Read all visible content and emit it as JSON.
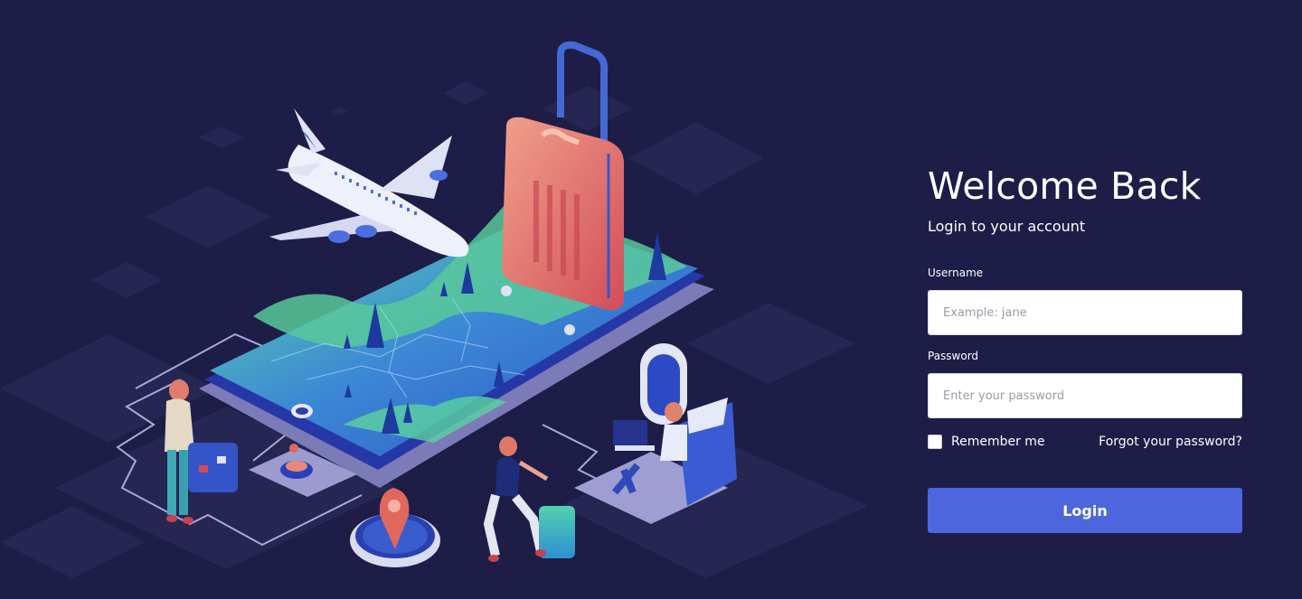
{
  "login": {
    "title": "Welcome Back",
    "subtitle": "Login to your account",
    "username_label": "Username",
    "username_placeholder": "Example: jane",
    "username_value": "",
    "password_label": "Password",
    "password_placeholder": "Enter your password",
    "password_value": "",
    "remember_label": "Remember me",
    "remember_checked": false,
    "forgot_label": "Forgot your password?",
    "login_button_label": "Login"
  },
  "colors": {
    "background": "#1d1d47",
    "accent": "#4d66de",
    "text": "#ffffff"
  },
  "hero": {
    "icons": [
      "airplane-icon",
      "suitcase-icon",
      "phone-map-icon",
      "traveler-icon",
      "compass-icon",
      "seat-icon"
    ]
  }
}
